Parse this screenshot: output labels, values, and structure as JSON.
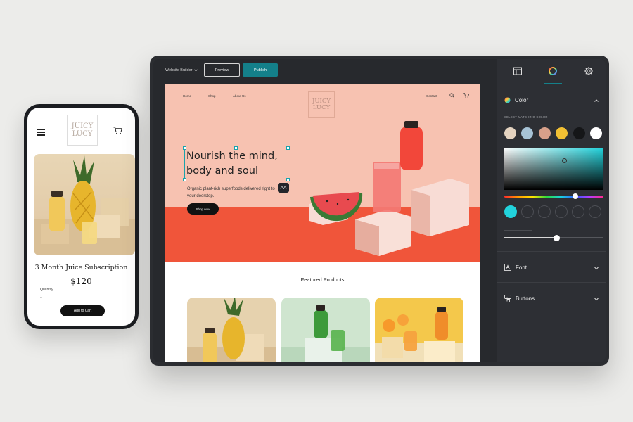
{
  "phone": {
    "logo_line1": "JUICY",
    "logo_line2": "LUCY",
    "menu_icon": "hamburger-icon",
    "cart_icon": "cart-icon",
    "product_title": "3 Month Juice Subscription",
    "price": "$120",
    "quantity_label": "Quantity",
    "quantity_value": "1",
    "add_to_cart": "Add to Cart"
  },
  "editor": {
    "site_selector": "Website Builder",
    "preview_label": "Preview",
    "publish_label": "Publish",
    "accent_color": "#14808a",
    "site": {
      "logo_line1": "JUICY",
      "logo_line2": "LUCY",
      "nav": [
        "Home",
        "Shop",
        "About Us"
      ],
      "contact": "Contact",
      "hero_title": "Nourish the mind, body and soul",
      "hero_subtitle": "Organic plant-rich superfoods delivered right to your doorstep.",
      "hero_button": "Shop now",
      "text_tool_label": "AA",
      "featured_title": "Featured Products"
    },
    "panel": {
      "tabs": [
        "layout-icon",
        "color-wheel-icon",
        "settings-icon"
      ],
      "active_tab": "color-wheel-icon",
      "color_section": "Color",
      "select_color_label": "SELECT MATCHING COLOR",
      "swatches": [
        "#e4d3c0",
        "#a7c3d6",
        "#d7a08a",
        "#f2c033",
        "#151618",
        "#ffffff"
      ],
      "picker_hue": "#22d3dc",
      "font_section": "Font",
      "buttons_section": "Buttons"
    }
  }
}
